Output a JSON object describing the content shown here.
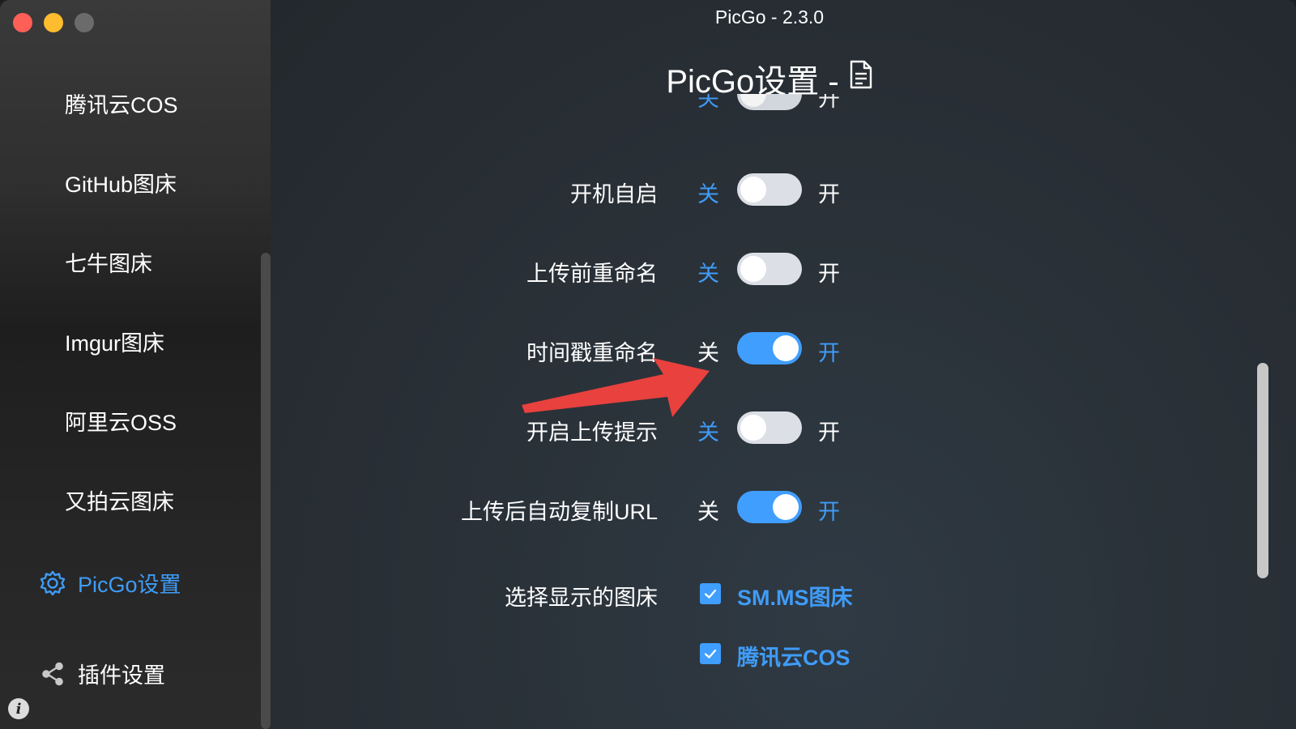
{
  "window": {
    "app_title": "PicGo - 2.3.0"
  },
  "sidebar": {
    "items": [
      {
        "label": "腾讯云COS"
      },
      {
        "label": "GitHub图床"
      },
      {
        "label": "七牛图床"
      },
      {
        "label": "Imgur图床"
      },
      {
        "label": "阿里云OSS"
      },
      {
        "label": "又拍云图床"
      },
      {
        "label": "PicGo设置",
        "icon": "gear-icon",
        "active": true
      },
      {
        "label": "插件设置",
        "icon": "share-icon"
      }
    ],
    "info_icon": "i"
  },
  "main": {
    "page_title": "PicGo设置 -",
    "doc_icon": "document-icon",
    "off_label": "关",
    "on_label": "开",
    "rows": [
      {
        "label": "开机自启",
        "on": false
      },
      {
        "label": "上传前重命名",
        "on": false
      },
      {
        "label": "时间戳重命名",
        "on": true
      },
      {
        "label": "开启上传提示",
        "on": false
      },
      {
        "label": "上传后自动复制URL",
        "on": true
      }
    ],
    "partial_row": {
      "on": false
    },
    "picbed_select": {
      "label": "选择显示的图床",
      "options": [
        {
          "label": "SM.MS图床",
          "checked": true
        },
        {
          "label": "腾讯云COS",
          "checked": true
        }
      ]
    }
  },
  "colors": {
    "accent": "#409eff",
    "accent_text": "#3f9cf7",
    "annotation_arrow": "#e8413e"
  }
}
